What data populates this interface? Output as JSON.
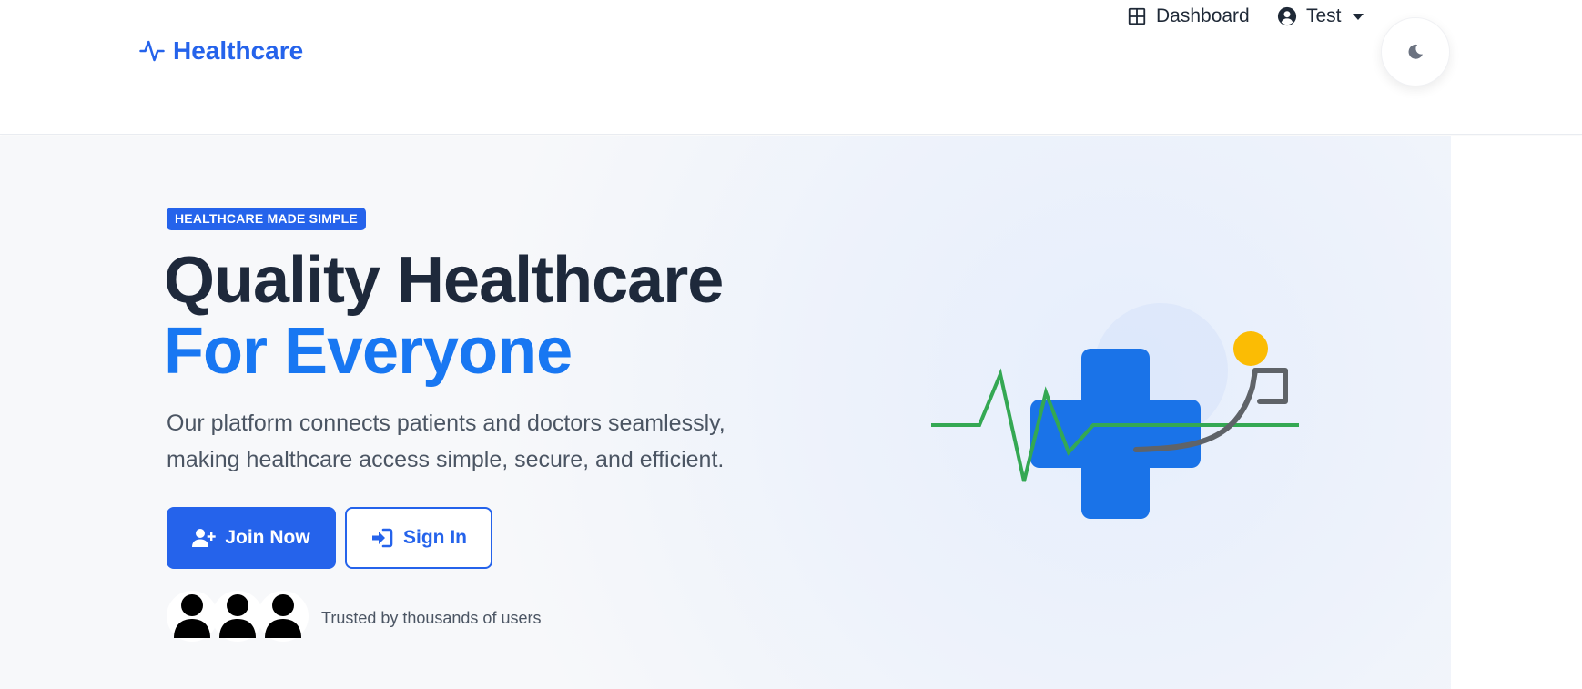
{
  "navbar": {
    "brand": "Healthcare",
    "links": [
      {
        "label": "Dashboard",
        "icon": "grid-icon"
      },
      {
        "label": "Test",
        "icon": "user-circle-icon"
      }
    ],
    "theme_toggle_icon": "moon-icon"
  },
  "hero": {
    "badge": "HEALTHCARE MADE SIMPLE",
    "title_line1": "Quality Healthcare",
    "title_line2": "For Everyone",
    "subtitle": "Our platform connects patients and doctors seamlessly, making healthcare access simple, secure, and efficient.",
    "primary_button": "Join Now",
    "secondary_button": "Sign In",
    "trust_text": "Trusted by thousands of users"
  },
  "colors": {
    "brand": "#2563eb",
    "accent": "#1877f2",
    "heading": "#1e293b",
    "ecg_green": "#34a853",
    "stethoscope_yellow": "#fbbc04"
  }
}
